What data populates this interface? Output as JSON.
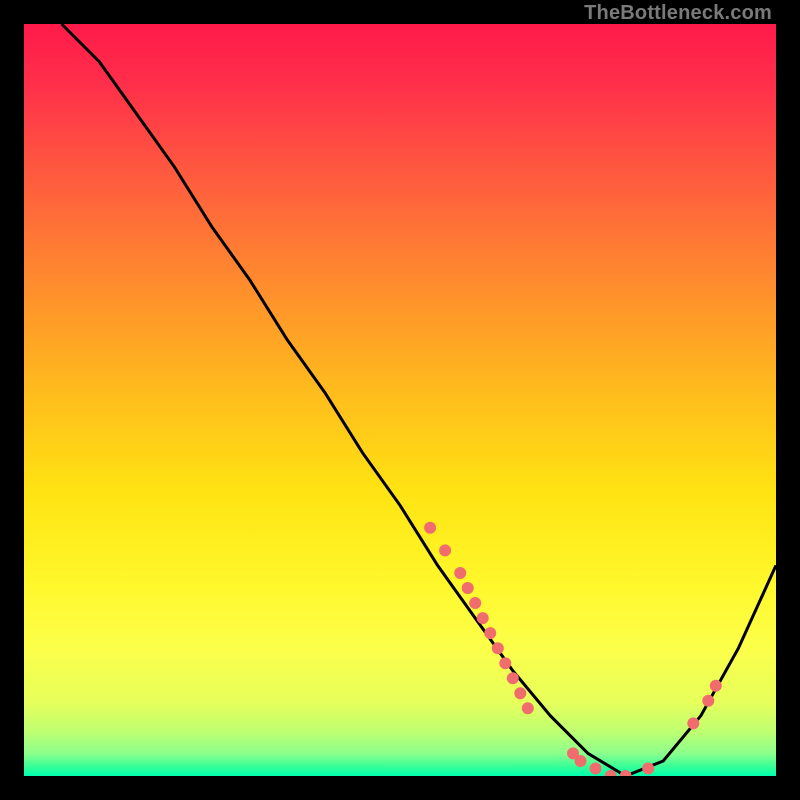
{
  "watermark": "TheBottleneck.com",
  "chart_data": {
    "type": "line",
    "title": "",
    "xlabel": "",
    "ylabel": "",
    "xlim": [
      0,
      100
    ],
    "ylim": [
      0,
      100
    ],
    "grid": false,
    "legend": false,
    "background_gradient": {
      "top_color": "#ff1a4a",
      "middle_color": "#ffe312",
      "bottom_color": "#00ffb0"
    },
    "series": [
      {
        "name": "bottleneck-curve",
        "x": [
          5,
          10,
          15,
          20,
          25,
          30,
          35,
          40,
          45,
          50,
          55,
          60,
          65,
          70,
          75,
          80,
          85,
          90,
          95,
          100
        ],
        "values": [
          100,
          95,
          88,
          81,
          73,
          66,
          58,
          51,
          43,
          36,
          28,
          21,
          14,
          8,
          3,
          0,
          2,
          8,
          17,
          28
        ]
      }
    ],
    "points": [
      {
        "x": 54,
        "y": 33
      },
      {
        "x": 56,
        "y": 30
      },
      {
        "x": 58,
        "y": 27
      },
      {
        "x": 59,
        "y": 25
      },
      {
        "x": 60,
        "y": 23
      },
      {
        "x": 61,
        "y": 21
      },
      {
        "x": 62,
        "y": 19
      },
      {
        "x": 63,
        "y": 17
      },
      {
        "x": 64,
        "y": 15
      },
      {
        "x": 65,
        "y": 13
      },
      {
        "x": 66,
        "y": 11
      },
      {
        "x": 67,
        "y": 9
      },
      {
        "x": 73,
        "y": 3
      },
      {
        "x": 74,
        "y": 2
      },
      {
        "x": 76,
        "y": 1
      },
      {
        "x": 78,
        "y": 0
      },
      {
        "x": 80,
        "y": 0
      },
      {
        "x": 83,
        "y": 1
      },
      {
        "x": 89,
        "y": 7
      },
      {
        "x": 91,
        "y": 10
      },
      {
        "x": 92,
        "y": 12
      }
    ],
    "point_color": "#f16c6c",
    "curve_color": "#000000"
  }
}
